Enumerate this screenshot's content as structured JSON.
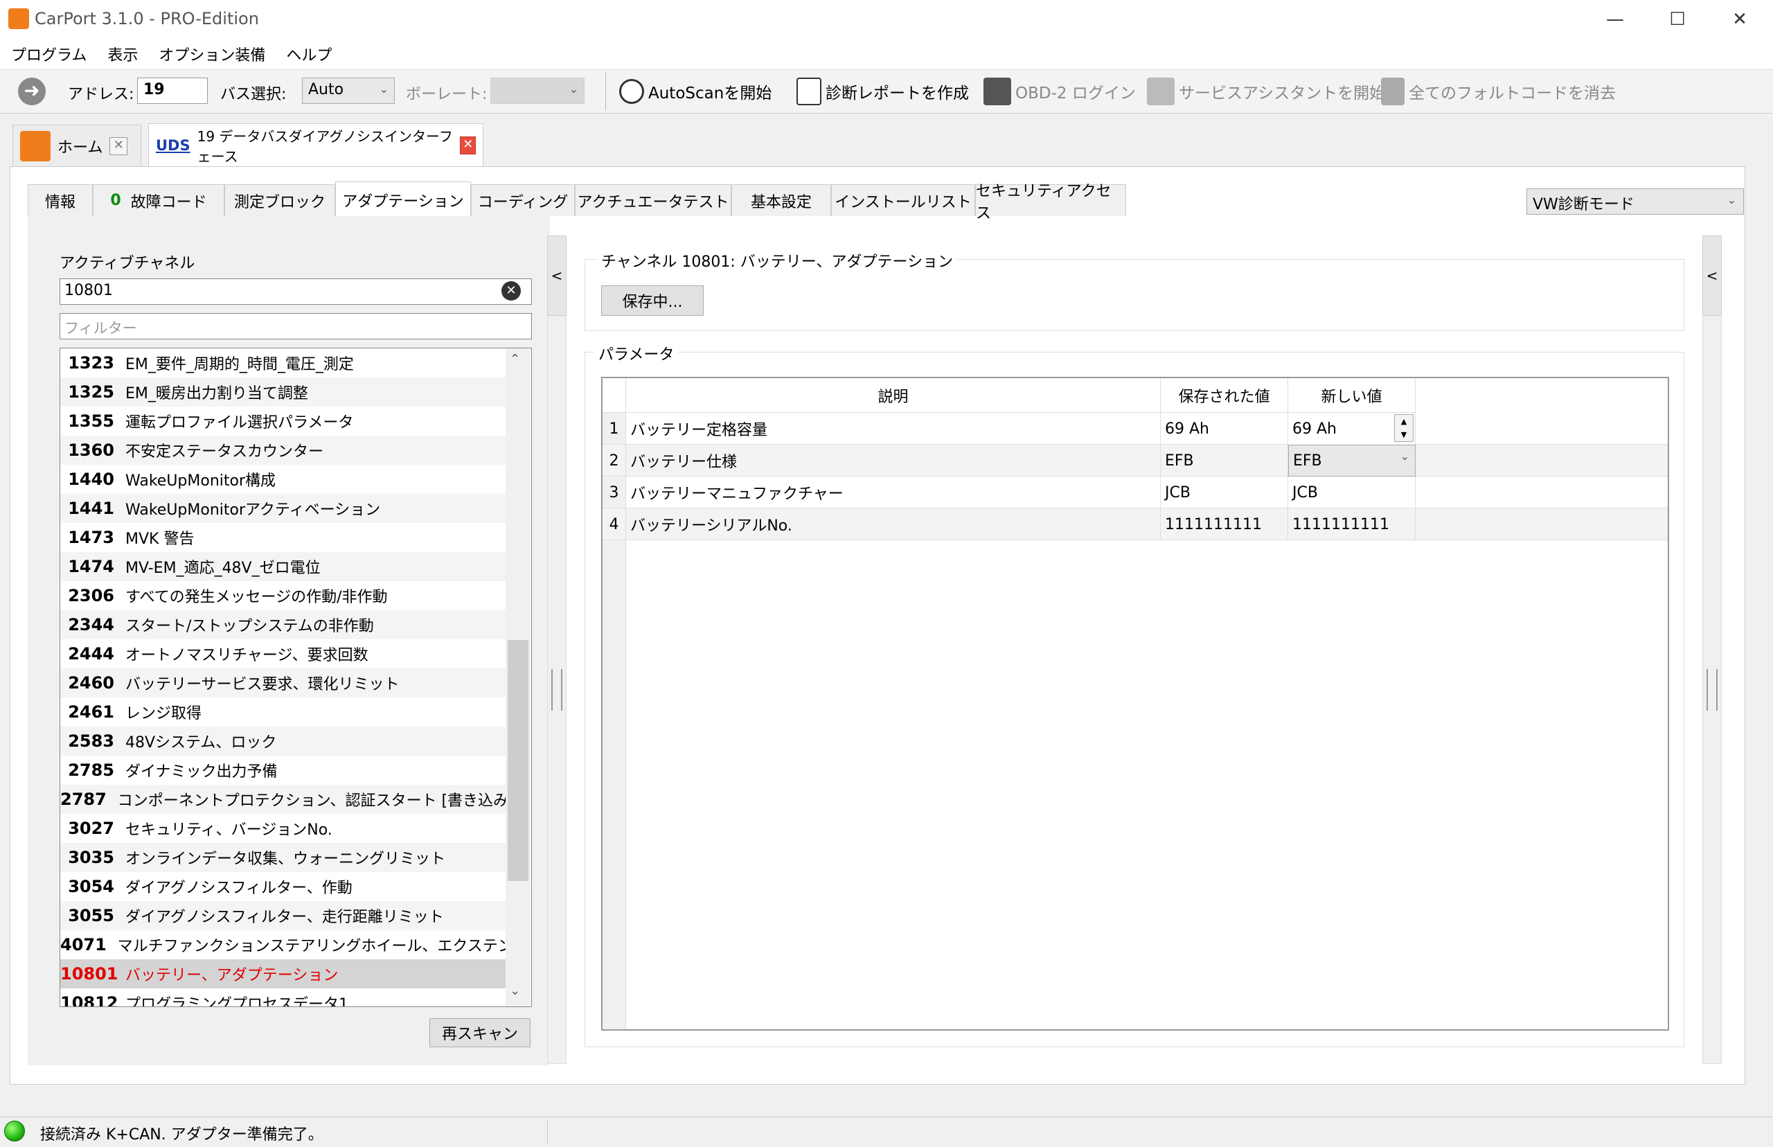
{
  "window": {
    "title": "CarPort 3.1.0 - PRO-Edition"
  },
  "menu": [
    "プログラム",
    "表示",
    "オプション装備",
    "ヘルプ"
  ],
  "toolbar": {
    "address_label": "アドレス:",
    "address_value": "19",
    "bus_label": "バス選択:",
    "bus_value": "Auto",
    "baud_label": "ボーレート:",
    "autoscan": "AutoScanを開始",
    "report": "診断レポートを作成",
    "obd_login": "OBD-2 ログイン",
    "service": "サービスアシスタントを開始",
    "clear_faults": "全てのフォルトコードを消去"
  },
  "doc_tabs": {
    "home": "ホーム",
    "uds_badge": "UDS",
    "uds_title": "19 データバスダイアグノシスインターフェース"
  },
  "sub_tabs": {
    "info": "情報",
    "fault_count": "0",
    "fault": "故障コード",
    "measure": "測定ブロック",
    "adaptation": "アダプテーション",
    "coding": "コーディング",
    "actuator": "アクチュエータテスト",
    "basic": "基本設定",
    "install": "インストールリスト",
    "security": "セキュリティアクセス"
  },
  "mode_select": "VW診断モード",
  "left": {
    "active_channel_label": "アクティブチャネル",
    "channel_value": "10801",
    "filter_placeholder": "フィルター",
    "rescan": "再スキャン",
    "items": [
      {
        "num": "1323",
        "label": "EM_要件_周期的_時間_電圧_測定"
      },
      {
        "num": "1325",
        "label": "EM_暖房出力割り当て調整"
      },
      {
        "num": "1355",
        "label": "運転プロファイル選択パラメータ"
      },
      {
        "num": "1360",
        "label": "不安定ステータスカウンター"
      },
      {
        "num": "1440",
        "label": "WakeUpMonitor構成"
      },
      {
        "num": "1441",
        "label": "WakeUpMonitorアクティベーション"
      },
      {
        "num": "1473",
        "label": "MVK 警告"
      },
      {
        "num": "1474",
        "label": "MV-EM_適応_48V_ゼロ電位"
      },
      {
        "num": "2306",
        "label": "すべての発生メッセージの作動/非作動"
      },
      {
        "num": "2344",
        "label": "スタート/ストップシステムの非作動"
      },
      {
        "num": "2444",
        "label": "オートノマスリチャージ、要求回数"
      },
      {
        "num": "2460",
        "label": "バッテリーサービス要求、環化リミット"
      },
      {
        "num": "2461",
        "label": "レンジ取得"
      },
      {
        "num": "2583",
        "label": "48Vシステム、ロック"
      },
      {
        "num": "2785",
        "label": "ダイナミック出力予備"
      },
      {
        "num": "2787",
        "label": "コンポーネントプロテクション、認証スタート [書き込み専用]"
      },
      {
        "num": "3027",
        "label": "セキュリティ、バージョンNo."
      },
      {
        "num": "3035",
        "label": "オンラインデータ収集、ウォーニングリミット"
      },
      {
        "num": "3054",
        "label": "ダイアグノシスフィルター、作動"
      },
      {
        "num": "3055",
        "label": "ダイアグノシスフィルター、走行距離リミット"
      },
      {
        "num": "4071",
        "label": "マルチファンクションステアリングホイール、エクステンデッドアダプテーション"
      },
      {
        "num": "10801",
        "label": "バッテリー、アダプテーション"
      },
      {
        "num": "10812",
        "label": "プログラミングプロセスデータ1"
      }
    ]
  },
  "right": {
    "channel_title": "チャンネル 10801: バッテリー、アダプテーション",
    "saving_btn": "保存中...",
    "params_title": "パラメータ",
    "headers": {
      "desc": "説明",
      "saved": "保存された値",
      "new": "新しい値"
    },
    "rows": [
      {
        "n": "1",
        "desc": "バッテリー定格容量",
        "saved": "69 Ah",
        "new": "69 Ah"
      },
      {
        "n": "2",
        "desc": "バッテリー仕様",
        "saved": "EFB",
        "new": "EFB"
      },
      {
        "n": "3",
        "desc": "バッテリーマニュファクチャー",
        "saved": "JCB",
        "new": "JCB"
      },
      {
        "n": "4",
        "desc": "バッテリーシリアルNo.",
        "saved": "1111111111",
        "new": "1111111111"
      }
    ]
  },
  "status": {
    "text": "接続済み K+CAN. アダプター準備完了。"
  },
  "colors": {
    "accent_orange": "#f07d1c",
    "selected_red": "#e00000",
    "status_green": "#1fb311"
  }
}
